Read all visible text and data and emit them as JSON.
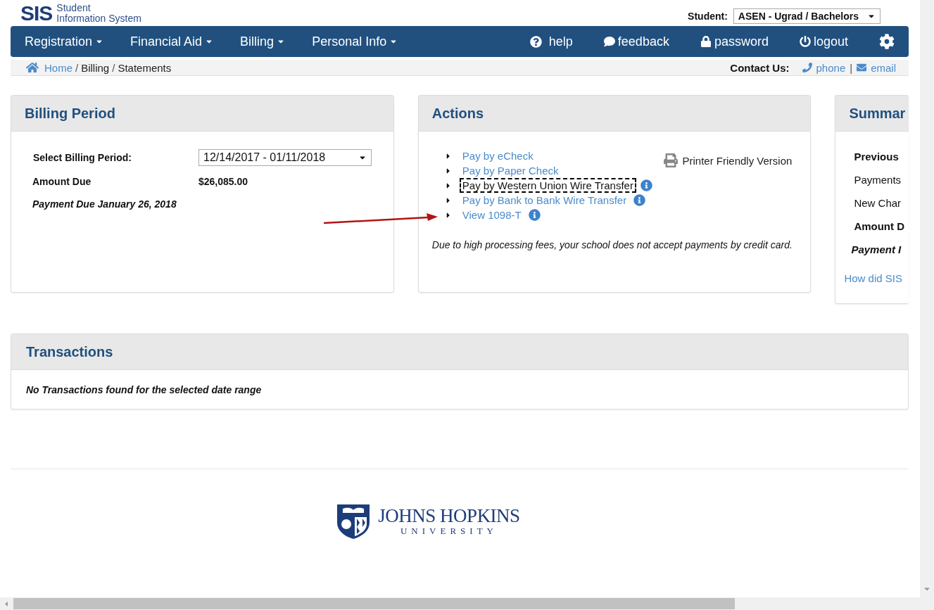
{
  "header": {
    "logo_mark": "SIS",
    "logo_line1": "Student",
    "logo_line2": "Information System",
    "student_label": "Student:",
    "student_value": "ASEN - Ugrad / Bachelors"
  },
  "nav": {
    "left": [
      {
        "label": "Registration",
        "dropdown": true
      },
      {
        "label": "Financial Aid",
        "dropdown": true
      },
      {
        "label": "Billing",
        "dropdown": true
      },
      {
        "label": "Personal Info",
        "dropdown": true
      }
    ],
    "right": [
      {
        "kind": "help",
        "label": "help"
      },
      {
        "kind": "feedback",
        "label": "feedback"
      },
      {
        "kind": "password",
        "label": "password"
      },
      {
        "kind": "logout",
        "label": "logout"
      },
      {
        "kind": "settings"
      }
    ]
  },
  "breadcrumb": {
    "items": [
      {
        "label": "Home",
        "link": true
      },
      {
        "label": "Billing",
        "link": false
      },
      {
        "label": "Statements",
        "link": false
      }
    ],
    "separator": "/",
    "contact_label": "Contact Us:",
    "contact_separator": "|",
    "contact_links": [
      {
        "kind": "phone",
        "label": "phone"
      },
      {
        "kind": "email",
        "label": "email"
      }
    ]
  },
  "billing_period": {
    "title": "Billing Period",
    "select_label": "Select Billing Period:",
    "select_value": "12/14/2017 - 01/11/2018",
    "amount_label": "Amount Due",
    "amount_value": "$26,085.00",
    "due_text": "Payment Due January 26, 2018"
  },
  "actions": {
    "title": "Actions",
    "items": [
      {
        "label": "Pay by eCheck",
        "info": false,
        "focused": false
      },
      {
        "label": "Pay by Paper Check",
        "info": false,
        "focused": false
      },
      {
        "label": "Pay by Western Union Wire Transfer",
        "info": true,
        "focused": true
      },
      {
        "label": "Pay by Bank to Bank Wire Transfer",
        "info": true,
        "focused": false
      },
      {
        "label": "View 1098-T",
        "info": true,
        "focused": false
      }
    ],
    "printer_label": "Printer Friendly Version",
    "note": "Due to high processing fees, your school does not accept payments by credit card."
  },
  "summary": {
    "title": "Summar",
    "rows": [
      {
        "kind": "bold",
        "text": "Previous"
      },
      {
        "kind": "plain",
        "text": "Payments"
      },
      {
        "kind": "plain",
        "text": "New Char"
      },
      {
        "kind": "bold",
        "text": "Amount D"
      },
      {
        "kind": "bold-italic",
        "text": "Payment I"
      }
    ],
    "link": "How did SIS"
  },
  "transactions": {
    "title": "Transactions",
    "empty_text": "No Transactions found for the selected date range"
  },
  "footer": {
    "logo_line1": "JOHNS HOPKINS",
    "logo_line2": "UNIVERSITY"
  }
}
